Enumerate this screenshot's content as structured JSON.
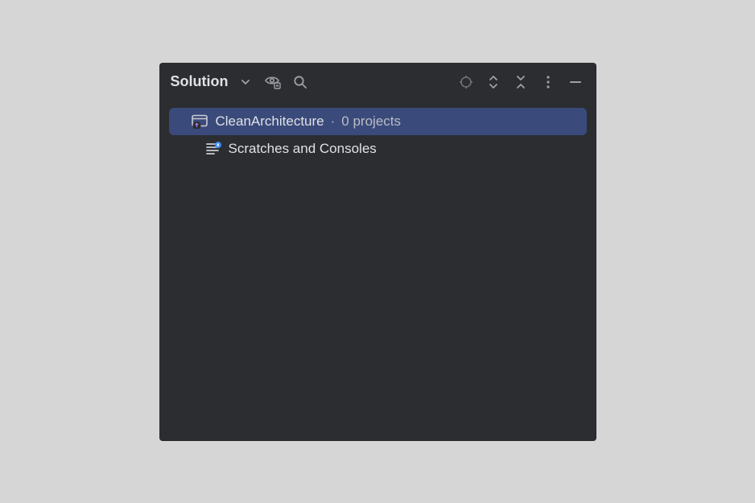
{
  "header": {
    "title": "Solution"
  },
  "tree": {
    "solution": {
      "name": "CleanArchitecture",
      "projects_label": "0 projects"
    },
    "scratches": {
      "label": "Scratches and Consoles"
    }
  }
}
